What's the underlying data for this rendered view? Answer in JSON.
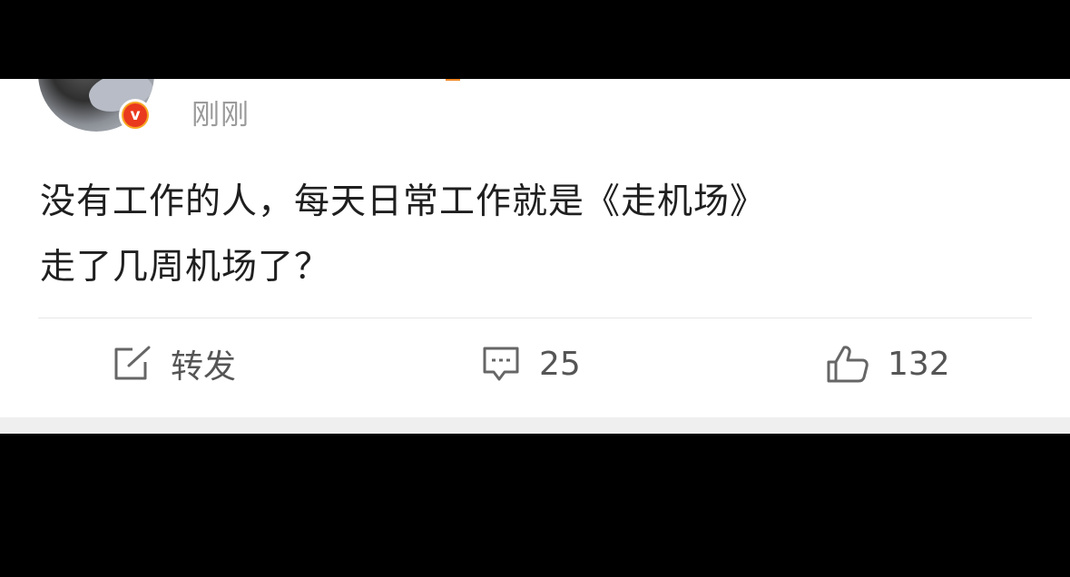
{
  "post": {
    "timestamp": "刚刚",
    "text_lines": [
      "没有工作的人，每天日常工作就是《走机场》",
      "走了几周机场了？"
    ]
  },
  "actions": {
    "repost_label": "转发",
    "comment_count": "25",
    "like_count": "132"
  },
  "icons": {
    "repost": "share-box-icon",
    "comment": "comment-bubble-icon",
    "like": "thumbs-up-icon",
    "verified": "verified-v-badge-icon"
  },
  "colors": {
    "badge_outer": "#f6a623",
    "badge_inner": "#ea3a1e",
    "text": "#1f1f1f",
    "muted": "#9a9a9a"
  }
}
